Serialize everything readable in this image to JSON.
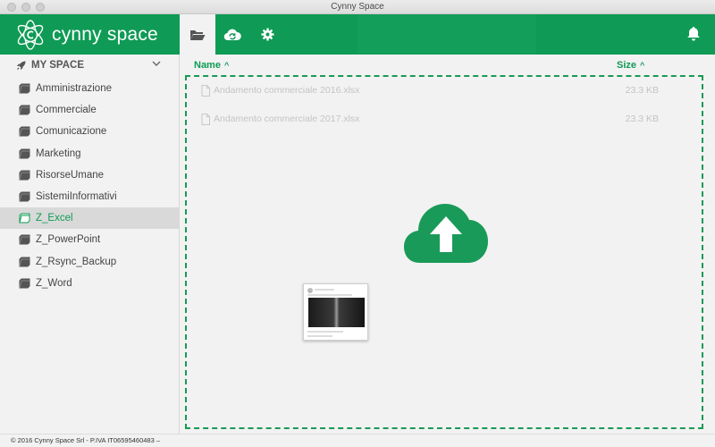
{
  "window": {
    "title": "Cynny Space"
  },
  "header": {
    "logo_text": "cynny space",
    "tabs": [
      {
        "icon": "folder-open-icon"
      },
      {
        "icon": "cloud-sync-icon"
      },
      {
        "icon": "gear-icon"
      }
    ],
    "right_icon": "bell-icon"
  },
  "sidebar": {
    "title": "MY SPACE",
    "items": [
      {
        "label": "Amministrazione"
      },
      {
        "label": "Commerciale"
      },
      {
        "label": "Comunicazione"
      },
      {
        "label": "Marketing"
      },
      {
        "label": "RisorseUmane"
      },
      {
        "label": "SistemiInformativi"
      },
      {
        "label": "Z_Excel"
      },
      {
        "label": "Z_PowerPoint"
      },
      {
        "label": "Z_Rsync_Backup"
      },
      {
        "label": "Z_Word"
      }
    ],
    "selected": "Z_Excel"
  },
  "table": {
    "columns": {
      "name": "Name",
      "size": "Size"
    },
    "rows": [
      {
        "name": "Andamento commerciale 2016.xlsx",
        "size": "23.3 KB"
      },
      {
        "name": "Andamento commerciale 2017.xlsx",
        "size": "23.3 KB"
      }
    ]
  },
  "upload": {
    "icon": "cloud-upload-icon"
  },
  "footer": {
    "text": "© 2016 Cynny Space Srl - P.IVA IT06595460483 –"
  },
  "colors": {
    "brand": "#0f9b55",
    "background": "#f2f2f2"
  }
}
